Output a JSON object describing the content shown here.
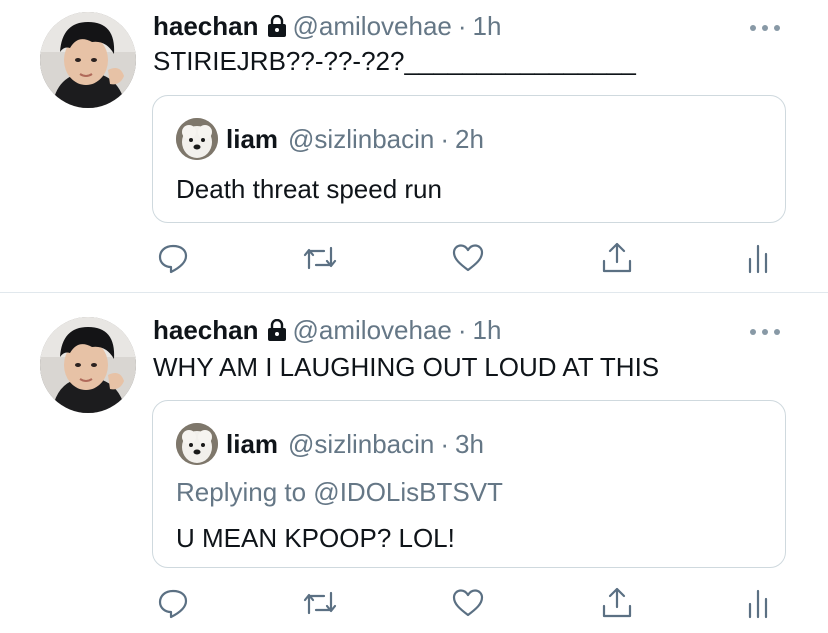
{
  "colors": {
    "text": "#0f1419",
    "secondary": "#657786",
    "border": "#cfd9de",
    "icon": "#5b7083"
  },
  "tweets": [
    {
      "author": {
        "name": "haechan",
        "handle": "@amilovehae",
        "time": "1h",
        "protected_icon": "lock-icon"
      },
      "text": "STIRIEJRB??-??-?2?________________",
      "quote": {
        "name": "liam",
        "handle": "@sizlinbacin",
        "time": "2h",
        "reply_to": null,
        "text": "Death threat speed run"
      },
      "actions": [
        "reply-icon",
        "retweet-icon",
        "like-icon",
        "share-icon",
        "analytics-icon"
      ]
    },
    {
      "author": {
        "name": "haechan",
        "handle": "@amilovehae",
        "time": "1h",
        "protected_icon": "lock-icon"
      },
      "text": "WHY AM I LAUGHING OUT LOUD AT THIS",
      "quote": {
        "name": "liam",
        "handle": "@sizlinbacin",
        "time": "3h",
        "reply_to": "Replying to @IDOLisBTSVT",
        "text": "U MEAN KPOOP? LOL!"
      },
      "actions": [
        "reply-icon",
        "retweet-icon",
        "like-icon",
        "share-icon",
        "analytics-icon"
      ]
    }
  ],
  "separator": "·"
}
